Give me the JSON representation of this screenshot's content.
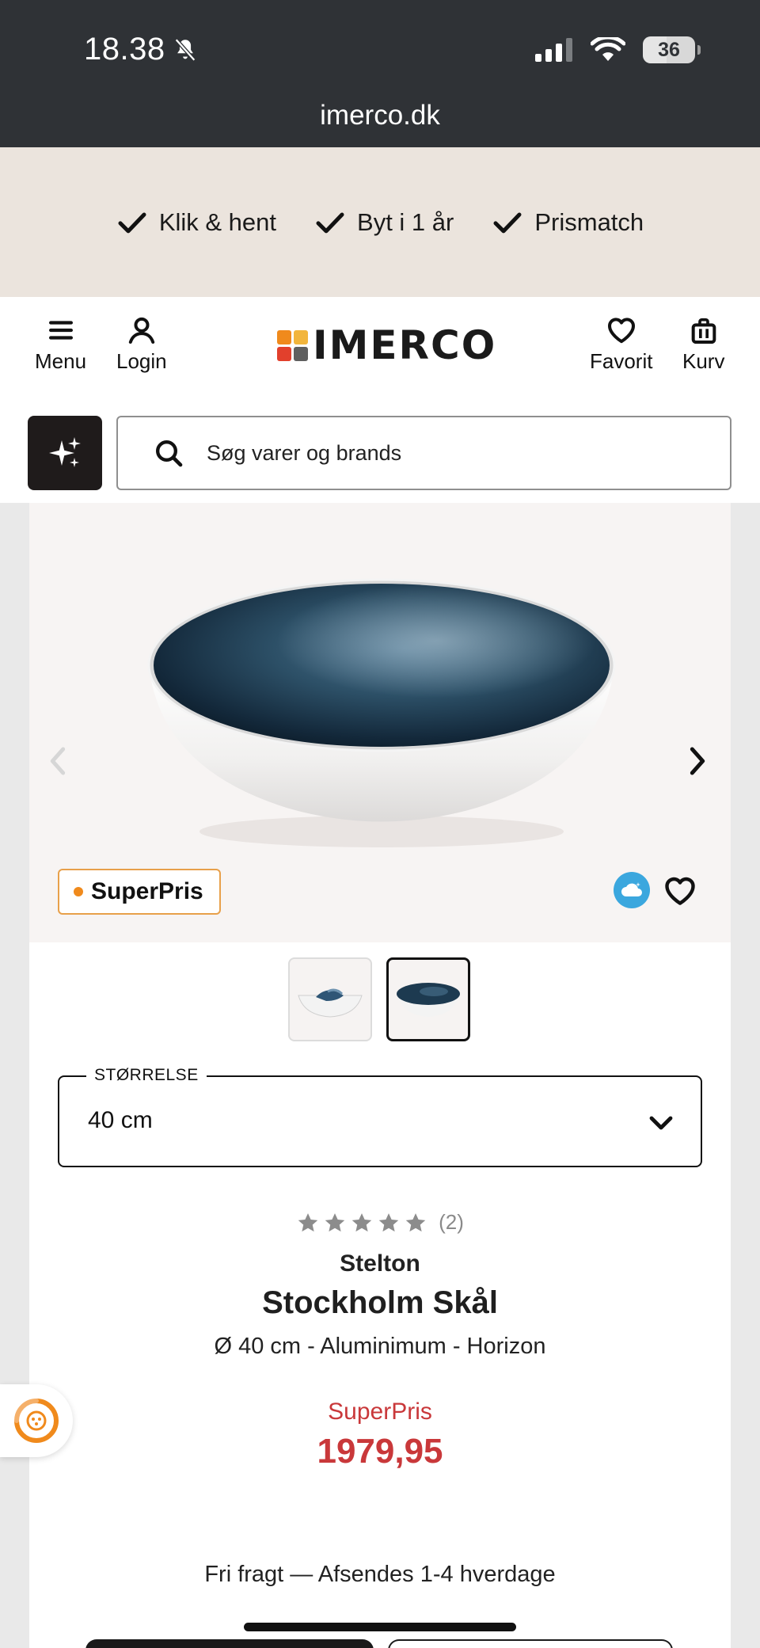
{
  "status_bar": {
    "time": "18.38",
    "battery": "36",
    "url": "imerco.dk"
  },
  "usp": [
    {
      "label": "Klik & hent"
    },
    {
      "label": "Byt i 1 år"
    },
    {
      "label": "Prismatch"
    }
  ],
  "header": {
    "menu_label": "Menu",
    "login_label": "Login",
    "logo_text": "IMERCO",
    "favorit_label": "Favorit",
    "kurv_label": "Kurv"
  },
  "search": {
    "placeholder": "Søg varer og brands"
  },
  "product": {
    "badge": "SuperPris",
    "size_label": "STØRRELSE",
    "size_value": "40 cm",
    "rating_count": "(2)",
    "rating": 0,
    "brand": "Stelton",
    "title": "Stockholm Skål",
    "subtitle": "Ø 40 cm - Aluminimum - Horizon",
    "price_label": "SuperPris",
    "price": "1979,95",
    "shipping": "Fri fragt — Afsendes 1-4 hverdage"
  },
  "colors": {
    "accent_red": "#c9383a",
    "badge_orange": "#e8a04a",
    "usp_background": "#ebe4dd",
    "status_bar": "#2f3236"
  }
}
